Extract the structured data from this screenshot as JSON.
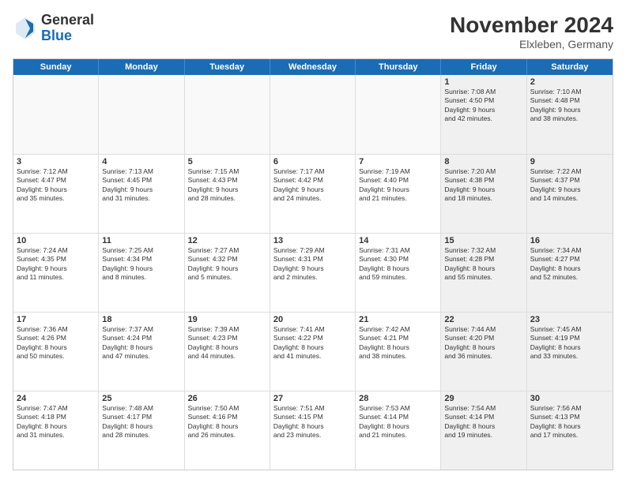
{
  "logo": {
    "general": "General",
    "blue": "Blue"
  },
  "title": {
    "month_year": "November 2024",
    "location": "Elxleben, Germany"
  },
  "header_days": [
    "Sunday",
    "Monday",
    "Tuesday",
    "Wednesday",
    "Thursday",
    "Friday",
    "Saturday"
  ],
  "weeks": [
    [
      {
        "day": "",
        "info": ""
      },
      {
        "day": "",
        "info": ""
      },
      {
        "day": "",
        "info": ""
      },
      {
        "day": "",
        "info": ""
      },
      {
        "day": "",
        "info": ""
      },
      {
        "day": "1",
        "info": "Sunrise: 7:08 AM\nSunset: 4:50 PM\nDaylight: 9 hours\nand 42 minutes."
      },
      {
        "day": "2",
        "info": "Sunrise: 7:10 AM\nSunset: 4:48 PM\nDaylight: 9 hours\nand 38 minutes."
      }
    ],
    [
      {
        "day": "3",
        "info": "Sunrise: 7:12 AM\nSunset: 4:47 PM\nDaylight: 9 hours\nand 35 minutes."
      },
      {
        "day": "4",
        "info": "Sunrise: 7:13 AM\nSunset: 4:45 PM\nDaylight: 9 hours\nand 31 minutes."
      },
      {
        "day": "5",
        "info": "Sunrise: 7:15 AM\nSunset: 4:43 PM\nDaylight: 9 hours\nand 28 minutes."
      },
      {
        "day": "6",
        "info": "Sunrise: 7:17 AM\nSunset: 4:42 PM\nDaylight: 9 hours\nand 24 minutes."
      },
      {
        "day": "7",
        "info": "Sunrise: 7:19 AM\nSunset: 4:40 PM\nDaylight: 9 hours\nand 21 minutes."
      },
      {
        "day": "8",
        "info": "Sunrise: 7:20 AM\nSunset: 4:38 PM\nDaylight: 9 hours\nand 18 minutes."
      },
      {
        "day": "9",
        "info": "Sunrise: 7:22 AM\nSunset: 4:37 PM\nDaylight: 9 hours\nand 14 minutes."
      }
    ],
    [
      {
        "day": "10",
        "info": "Sunrise: 7:24 AM\nSunset: 4:35 PM\nDaylight: 9 hours\nand 11 minutes."
      },
      {
        "day": "11",
        "info": "Sunrise: 7:25 AM\nSunset: 4:34 PM\nDaylight: 9 hours\nand 8 minutes."
      },
      {
        "day": "12",
        "info": "Sunrise: 7:27 AM\nSunset: 4:32 PM\nDaylight: 9 hours\nand 5 minutes."
      },
      {
        "day": "13",
        "info": "Sunrise: 7:29 AM\nSunset: 4:31 PM\nDaylight: 9 hours\nand 2 minutes."
      },
      {
        "day": "14",
        "info": "Sunrise: 7:31 AM\nSunset: 4:30 PM\nDaylight: 8 hours\nand 59 minutes."
      },
      {
        "day": "15",
        "info": "Sunrise: 7:32 AM\nSunset: 4:28 PM\nDaylight: 8 hours\nand 55 minutes."
      },
      {
        "day": "16",
        "info": "Sunrise: 7:34 AM\nSunset: 4:27 PM\nDaylight: 8 hours\nand 52 minutes."
      }
    ],
    [
      {
        "day": "17",
        "info": "Sunrise: 7:36 AM\nSunset: 4:26 PM\nDaylight: 8 hours\nand 50 minutes."
      },
      {
        "day": "18",
        "info": "Sunrise: 7:37 AM\nSunset: 4:24 PM\nDaylight: 8 hours\nand 47 minutes."
      },
      {
        "day": "19",
        "info": "Sunrise: 7:39 AM\nSunset: 4:23 PM\nDaylight: 8 hours\nand 44 minutes."
      },
      {
        "day": "20",
        "info": "Sunrise: 7:41 AM\nSunset: 4:22 PM\nDaylight: 8 hours\nand 41 minutes."
      },
      {
        "day": "21",
        "info": "Sunrise: 7:42 AM\nSunset: 4:21 PM\nDaylight: 8 hours\nand 38 minutes."
      },
      {
        "day": "22",
        "info": "Sunrise: 7:44 AM\nSunset: 4:20 PM\nDaylight: 8 hours\nand 36 minutes."
      },
      {
        "day": "23",
        "info": "Sunrise: 7:45 AM\nSunset: 4:19 PM\nDaylight: 8 hours\nand 33 minutes."
      }
    ],
    [
      {
        "day": "24",
        "info": "Sunrise: 7:47 AM\nSunset: 4:18 PM\nDaylight: 8 hours\nand 31 minutes."
      },
      {
        "day": "25",
        "info": "Sunrise: 7:48 AM\nSunset: 4:17 PM\nDaylight: 8 hours\nand 28 minutes."
      },
      {
        "day": "26",
        "info": "Sunrise: 7:50 AM\nSunset: 4:16 PM\nDaylight: 8 hours\nand 26 minutes."
      },
      {
        "day": "27",
        "info": "Sunrise: 7:51 AM\nSunset: 4:15 PM\nDaylight: 8 hours\nand 23 minutes."
      },
      {
        "day": "28",
        "info": "Sunrise: 7:53 AM\nSunset: 4:14 PM\nDaylight: 8 hours\nand 21 minutes."
      },
      {
        "day": "29",
        "info": "Sunrise: 7:54 AM\nSunset: 4:14 PM\nDaylight: 8 hours\nand 19 minutes."
      },
      {
        "day": "30",
        "info": "Sunrise: 7:56 AM\nSunset: 4:13 PM\nDaylight: 8 hours\nand 17 minutes."
      }
    ]
  ]
}
